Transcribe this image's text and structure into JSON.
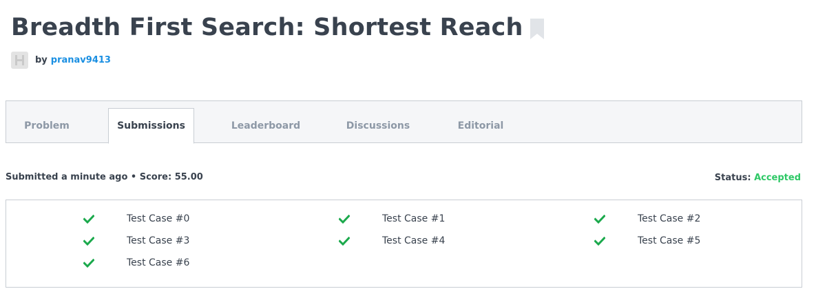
{
  "header": {
    "title": "Breadth First Search: Shortest Reach",
    "by_label": "by",
    "author": "pranav9413"
  },
  "tabs": [
    {
      "label": "Problem"
    },
    {
      "label": "Submissions",
      "active": true
    },
    {
      "label": "Leaderboard"
    },
    {
      "label": "Discussions"
    },
    {
      "label": "Editorial"
    }
  ],
  "submission": {
    "summary": "Submitted a minute ago • Score: 55.00",
    "status_label": "Status:",
    "status_value": "Accepted"
  },
  "test_cases": [
    {
      "label": "Test Case #0",
      "passed": true
    },
    {
      "label": "Test Case #1",
      "passed": true
    },
    {
      "label": "Test Case #2",
      "passed": true
    },
    {
      "label": "Test Case #3",
      "passed": true
    },
    {
      "label": "Test Case #4",
      "passed": true
    },
    {
      "label": "Test Case #5",
      "passed": true
    },
    {
      "label": "Test Case #6",
      "passed": true
    }
  ],
  "colors": {
    "accent": "#1a8fe2",
    "success": "#2ec866",
    "check": "#1ba94c",
    "text": "#39424e",
    "muted": "#8d98a6"
  }
}
